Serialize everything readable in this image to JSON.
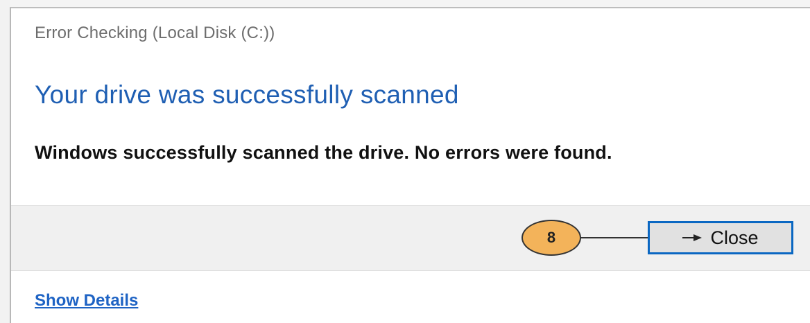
{
  "dialog": {
    "title": "Error Checking (Local Disk (C:))",
    "heading": "Your drive was successfully scanned",
    "message": "Windows successfully scanned the drive. No errors were found.",
    "close_label": "Close",
    "show_details_label": "Show Details"
  },
  "annotation": {
    "step_number": "8",
    "badge_color": "#f3b35a"
  },
  "colors": {
    "heading": "#1f5fb3",
    "link": "#1e63c4",
    "button_focus_border": "#0a67c2",
    "footer_bg": "#f0f0f0"
  },
  "icons": {
    "close_button_arrow": "arrow-right-icon"
  }
}
